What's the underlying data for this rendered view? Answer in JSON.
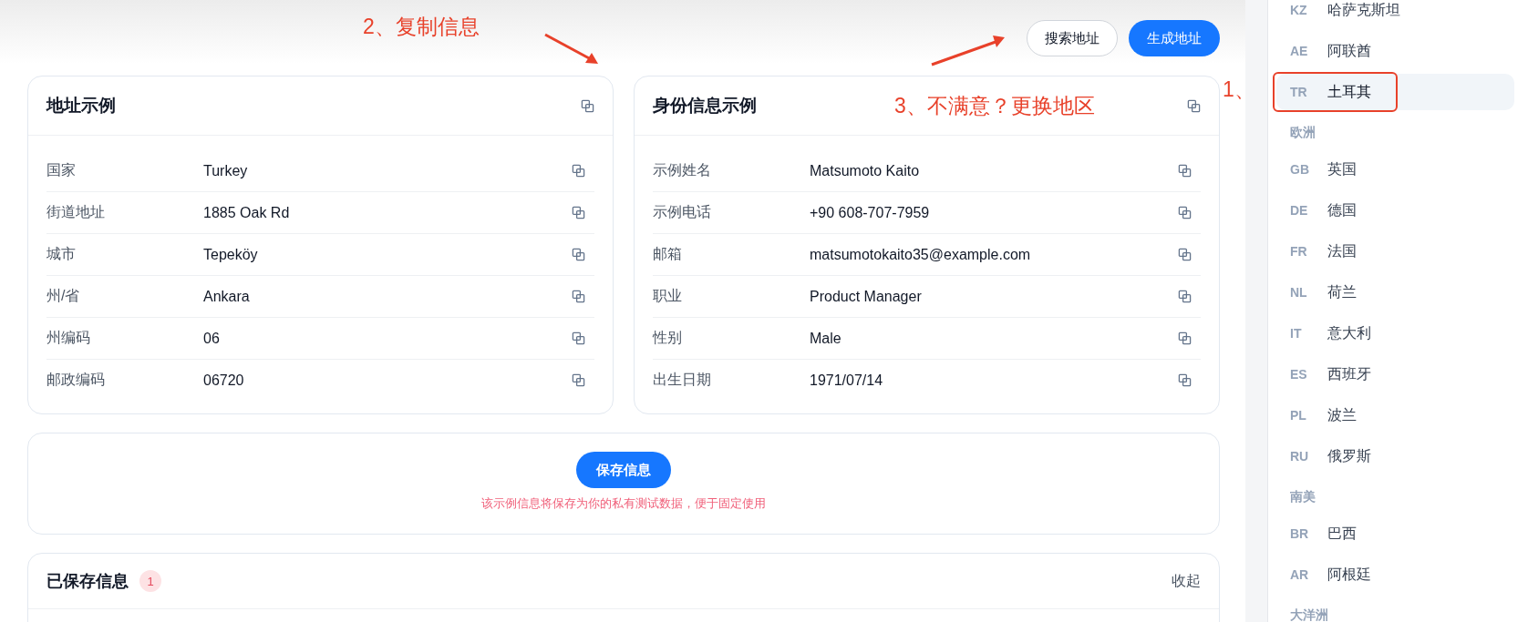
{
  "toolbar": {
    "buttons": [
      {
        "label": "搜索地址",
        "kind": "outline"
      },
      {
        "label": "生成地址",
        "kind": "primary"
      }
    ]
  },
  "cards": [
    {
      "title": "地址示例",
      "fields": [
        {
          "label": "国家",
          "value": "Turkey"
        },
        {
          "label": "街道地址",
          "value": "1885 Oak Rd"
        },
        {
          "label": "城市",
          "value": "Tepeköy"
        },
        {
          "label": "州/省",
          "value": "Ankara"
        },
        {
          "label": "州编码",
          "value": "06"
        },
        {
          "label": "邮政编码",
          "value": "06720"
        }
      ]
    },
    {
      "title": "身份信息示例",
      "fields": [
        {
          "label": "示例姓名",
          "value": "Matsumoto Kaito"
        },
        {
          "label": "示例电话",
          "value": "+90 608-707-7959"
        },
        {
          "label": "邮箱",
          "value": "matsumotokaito35@example.com"
        },
        {
          "label": "职业",
          "value": "Product Manager"
        },
        {
          "label": "性别",
          "value": "Male"
        },
        {
          "label": "出生日期",
          "value": "1971/07/14"
        }
      ]
    }
  ],
  "save": {
    "button": "保存信息",
    "note": "该示例信息将保存为你的私有测试数据，便于固定使用"
  },
  "saved": {
    "title": "已保存信息",
    "count": "1",
    "toggle": "收起"
  },
  "sidebar": {
    "items": [
      {
        "kind": "country",
        "code": "KZ",
        "name": "哈萨克斯坦",
        "selected": false,
        "marked": false
      },
      {
        "kind": "country",
        "code": "AE",
        "name": "阿联酋",
        "selected": false,
        "marked": false
      },
      {
        "kind": "country",
        "code": "TR",
        "name": "土耳其",
        "selected": true,
        "marked": true
      },
      {
        "kind": "group",
        "name": "欧洲"
      },
      {
        "kind": "country",
        "code": "GB",
        "name": "英国",
        "selected": false,
        "marked": false
      },
      {
        "kind": "country",
        "code": "DE",
        "name": "德国",
        "selected": false,
        "marked": false
      },
      {
        "kind": "country",
        "code": "FR",
        "name": "法国",
        "selected": false,
        "marked": false
      },
      {
        "kind": "country",
        "code": "NL",
        "name": "荷兰",
        "selected": false,
        "marked": false
      },
      {
        "kind": "country",
        "code": "IT",
        "name": "意大利",
        "selected": false,
        "marked": false
      },
      {
        "kind": "country",
        "code": "ES",
        "name": "西班牙",
        "selected": false,
        "marked": false
      },
      {
        "kind": "country",
        "code": "PL",
        "name": "波兰",
        "selected": false,
        "marked": false
      },
      {
        "kind": "country",
        "code": "RU",
        "name": "俄罗斯",
        "selected": false,
        "marked": false
      },
      {
        "kind": "group",
        "name": "南美"
      },
      {
        "kind": "country",
        "code": "BR",
        "name": "巴西",
        "selected": false,
        "marked": false
      },
      {
        "kind": "country",
        "code": "AR",
        "name": "阿根廷",
        "selected": false,
        "marked": false
      },
      {
        "kind": "group",
        "name": "大洋洲"
      }
    ]
  },
  "annotations": [
    {
      "text": "2、复制信息"
    },
    {
      "text": "3、不满意？更换地区"
    },
    {
      "text": "1、"
    }
  ]
}
